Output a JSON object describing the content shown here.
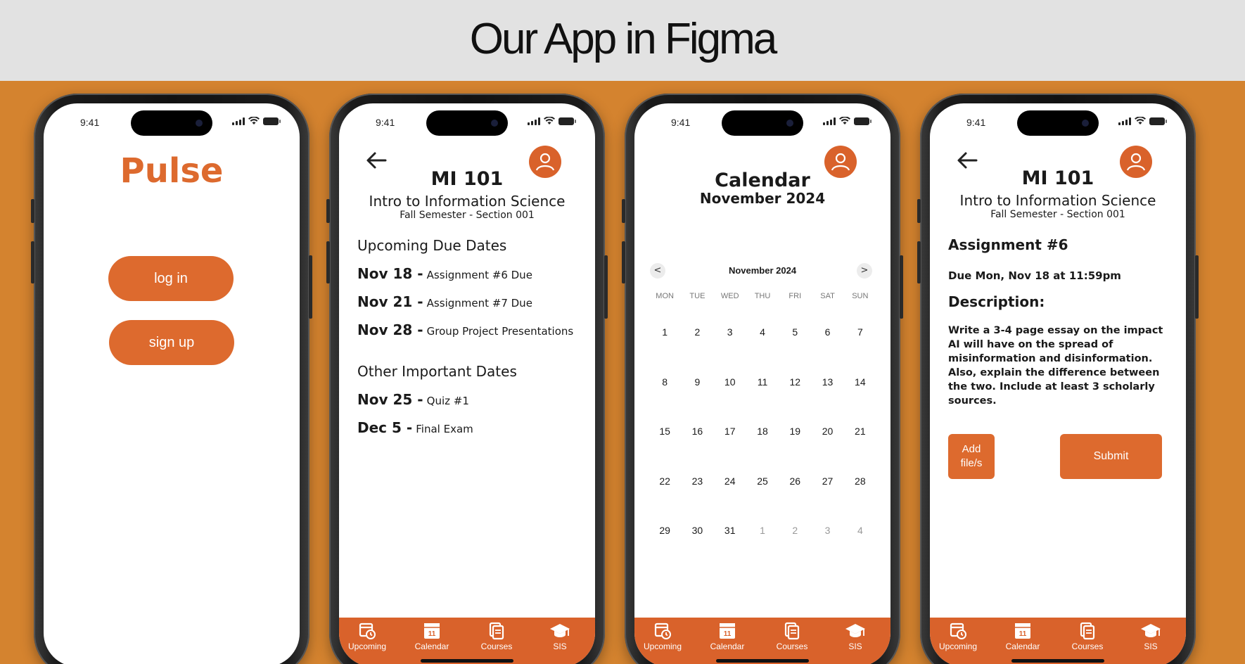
{
  "banner": {
    "title": "Our App in Figma"
  },
  "status": {
    "time": "9:41"
  },
  "colors": {
    "accent": "#dd6a2e",
    "background": "#d4832f",
    "banner": "#e2e2e2"
  },
  "tabs": [
    {
      "label": "Upcoming",
      "icon": "upcoming-icon"
    },
    {
      "label": "Calendar",
      "icon": "calendar-icon",
      "badge": "11"
    },
    {
      "label": "Courses",
      "icon": "courses-icon"
    },
    {
      "label": "SIS",
      "icon": "graduation-cap-icon"
    }
  ],
  "login": {
    "brand": "Pulse",
    "login_label": "log in",
    "signup_label": "sign up"
  },
  "course": {
    "code": "MI 101",
    "name": "Intro to Information Science",
    "section": "Fall Semester - Section 001",
    "upcoming_heading": "Upcoming Due Dates",
    "upcoming": [
      {
        "date": "Nov 18 -",
        "text": "Assignment #6 Due"
      },
      {
        "date": "Nov 21 -",
        "text": "Assignment #7 Due"
      },
      {
        "date": "Nov 28 -",
        "text": "Group Project Presentations"
      }
    ],
    "other_heading": "Other Important Dates",
    "other": [
      {
        "date": "Nov 25 -",
        "text": "Quiz #1"
      },
      {
        "date": "Dec 5 -",
        "text": "Final Exam"
      }
    ]
  },
  "calendar": {
    "title": "Calendar",
    "subtitle": "November 2024",
    "month_label": "November 2024",
    "prev": "<",
    "next": ">",
    "weekdays": [
      "MON",
      "TUE",
      "WED",
      "THU",
      "FRI",
      "SAT",
      "SUN"
    ],
    "weeks": [
      [
        "1",
        "2",
        "3",
        "4",
        "5",
        "6",
        "7"
      ],
      [
        "8",
        "9",
        "10",
        "11",
        "12",
        "13",
        "14"
      ],
      [
        "15",
        "16",
        "17",
        "18",
        "19",
        "20",
        "21"
      ],
      [
        "22",
        "23",
        "24",
        "25",
        "26",
        "27",
        "28"
      ],
      [
        "29",
        "30",
        "31",
        "1",
        "2",
        "3",
        "4"
      ]
    ],
    "muted_from_last_week_index": 3
  },
  "assignment": {
    "title": "Assignment #6",
    "due": "Due Mon, Nov 18 at 11:59pm",
    "desc_heading": "Description:",
    "description": "Write a 3-4 page essay on the impact AI will have on the spread of misinformation and disinformation. Also, explain the difference between the two. Include at least 3 scholarly sources.",
    "add_file_label": "Add file/s",
    "submit_label": "Submit"
  }
}
